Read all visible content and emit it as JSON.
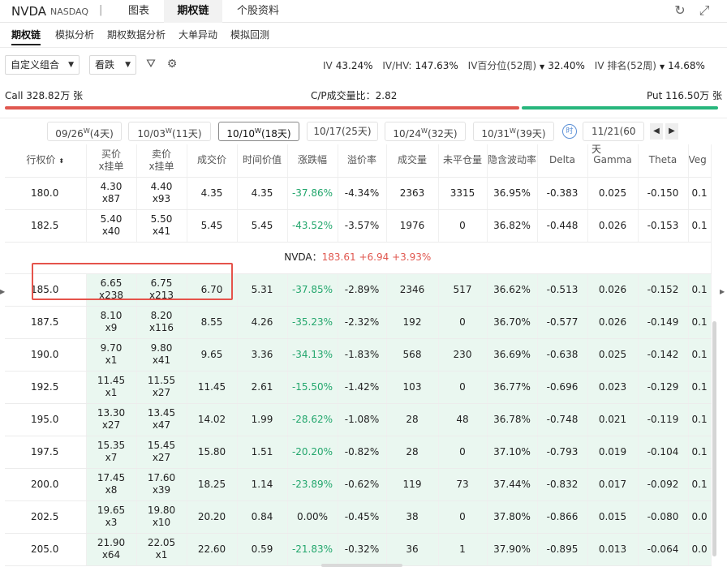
{
  "header": {
    "symbol": "NVDA",
    "exchange": "NASDAQ",
    "separator": "|",
    "tabs": [
      {
        "label": "图表",
        "active": false
      },
      {
        "label": "期权链",
        "active": true
      },
      {
        "label": "个股资料",
        "active": false
      }
    ]
  },
  "subtabs": [
    "期权链",
    "模拟分析",
    "期权数据分析",
    "大单异动",
    "模拟回测"
  ],
  "controls": {
    "strategy": "自定义组合",
    "direction": "看跌"
  },
  "iv_stats": [
    {
      "label": "IV",
      "value": "43.24%"
    },
    {
      "label": "IV/HV:",
      "value": "147.63%"
    },
    {
      "label": "IV百分位(52周)",
      "value": "32.40%"
    },
    {
      "label": "IV 排名(52周)",
      "value": "14.68%"
    }
  ],
  "volume": {
    "call": "Call 328.82万 张",
    "ratio": "C/P成交量比：2.82",
    "put": "Put 116.50万 张"
  },
  "expirations": [
    {
      "date": "09/26",
      "mark": "W",
      "days": "(4天)"
    },
    {
      "date": "10/03",
      "mark": "W",
      "days": "(11天)"
    },
    {
      "date": "10/10",
      "mark": "W",
      "days": "(18天)"
    },
    {
      "date": "10/17",
      "mark": "",
      "days": "(25天)"
    },
    {
      "date": "10/24",
      "mark": "W",
      "days": "(32天)"
    },
    {
      "date": "10/31",
      "mark": "W",
      "days": "(39天)"
    },
    {
      "date": "11/21",
      "mark": "",
      "days": "(60天"
    }
  ],
  "calendar_icon_label": "时",
  "columns": [
    "行权价",
    "买价\nx挂单",
    "卖价\nx挂单",
    "成交价",
    "时间价值",
    "涨跌幅",
    "溢价率",
    "成交量",
    "未平仓量",
    "隐含波动率",
    "Delta",
    "Gamma",
    "Theta",
    "Veg"
  ],
  "stock_line": {
    "label": "NVDA：",
    "price": "183.61",
    "change": "+6.94",
    "pct": "+3.93%"
  },
  "rows_otm": [
    {
      "strike": "180.0",
      "bid": "4.30",
      "bid_size": "x87",
      "ask": "4.40",
      "ask_size": "x93",
      "last": "4.35",
      "time_value": "4.35",
      "chg": "-37.86%",
      "premium": "-4.34%",
      "volume": "2363",
      "oi": "3315",
      "iv": "36.95%",
      "delta": "-0.383",
      "gamma": "0.025",
      "theta": "-0.150",
      "vega": "0.1"
    },
    {
      "strike": "182.5",
      "bid": "5.40",
      "bid_size": "x40",
      "ask": "5.50",
      "ask_size": "x41",
      "last": "5.45",
      "time_value": "5.45",
      "chg": "-43.52%",
      "premium": "-3.57%",
      "volume": "1976",
      "oi": "0",
      "iv": "36.82%",
      "delta": "-0.448",
      "gamma": "0.026",
      "theta": "-0.153",
      "vega": "0.1"
    }
  ],
  "rows_itm": [
    {
      "strike": "185.0",
      "bid": "6.65",
      "bid_size": "x238",
      "ask": "6.75",
      "ask_size": "x213",
      "last": "6.70",
      "time_value": "5.31",
      "chg": "-37.85%",
      "premium": "-2.89%",
      "volume": "2346",
      "oi": "517",
      "iv": "36.62%",
      "delta": "-0.513",
      "gamma": "0.026",
      "theta": "-0.152",
      "vega": "0.1"
    },
    {
      "strike": "187.5",
      "bid": "8.10",
      "bid_size": "x9",
      "ask": "8.20",
      "ask_size": "x116",
      "last": "8.55",
      "time_value": "4.26",
      "chg": "-35.23%",
      "premium": "-2.32%",
      "volume": "192",
      "oi": "0",
      "iv": "36.70%",
      "delta": "-0.577",
      "gamma": "0.026",
      "theta": "-0.149",
      "vega": "0.1"
    },
    {
      "strike": "190.0",
      "bid": "9.70",
      "bid_size": "x1",
      "ask": "9.80",
      "ask_size": "x41",
      "last": "9.65",
      "time_value": "3.36",
      "chg": "-34.13%",
      "premium": "-1.83%",
      "volume": "568",
      "oi": "230",
      "iv": "36.69%",
      "delta": "-0.638",
      "gamma": "0.025",
      "theta": "-0.142",
      "vega": "0.1"
    },
    {
      "strike": "192.5",
      "bid": "11.45",
      "bid_size": "x1",
      "ask": "11.55",
      "ask_size": "x27",
      "last": "11.45",
      "time_value": "2.61",
      "chg": "-15.50%",
      "premium": "-1.42%",
      "volume": "103",
      "oi": "0",
      "iv": "36.77%",
      "delta": "-0.696",
      "gamma": "0.023",
      "theta": "-0.129",
      "vega": "0.1"
    },
    {
      "strike": "195.0",
      "bid": "13.30",
      "bid_size": "x27",
      "ask": "13.45",
      "ask_size": "x47",
      "last": "14.02",
      "time_value": "1.99",
      "chg": "-28.62%",
      "premium": "-1.08%",
      "volume": "28",
      "oi": "48",
      "iv": "36.78%",
      "delta": "-0.748",
      "gamma": "0.021",
      "theta": "-0.119",
      "vega": "0.1"
    },
    {
      "strike": "197.5",
      "bid": "15.35",
      "bid_size": "x7",
      "ask": "15.45",
      "ask_size": "x27",
      "last": "15.80",
      "time_value": "1.51",
      "chg": "-20.20%",
      "premium": "-0.82%",
      "volume": "28",
      "oi": "0",
      "iv": "37.10%",
      "delta": "-0.793",
      "gamma": "0.019",
      "theta": "-0.104",
      "vega": "0.1"
    },
    {
      "strike": "200.0",
      "bid": "17.45",
      "bid_size": "x8",
      "ask": "17.60",
      "ask_size": "x39",
      "last": "18.25",
      "time_value": "1.14",
      "chg": "-23.89%",
      "premium": "-0.62%",
      "volume": "119",
      "oi": "73",
      "iv": "37.44%",
      "delta": "-0.832",
      "gamma": "0.017",
      "theta": "-0.092",
      "vega": "0.1"
    },
    {
      "strike": "202.5",
      "bid": "19.65",
      "bid_size": "x3",
      "ask": "19.80",
      "ask_size": "x10",
      "last": "20.20",
      "time_value": "0.84",
      "chg": "0.00%",
      "premium": "-0.45%",
      "volume": "38",
      "oi": "0",
      "iv": "37.80%",
      "delta": "-0.866",
      "gamma": "0.015",
      "theta": "-0.080",
      "vega": "0.0"
    },
    {
      "strike": "205.0",
      "bid": "21.90",
      "bid_size": "x64",
      "ask": "22.05",
      "ask_size": "x1",
      "last": "22.60",
      "time_value": "0.59",
      "chg": "-21.83%",
      "premium": "-0.32%",
      "volume": "36",
      "oi": "1",
      "iv": "37.90%",
      "delta": "-0.895",
      "gamma": "0.013",
      "theta": "-0.064",
      "vega": "0.0"
    }
  ],
  "colors": {
    "up": "#e0574f",
    "down": "#22a66c",
    "itm_bg": "#eaf7f0",
    "highlight_box": "#e5534b"
  },
  "icons": {
    "refresh": "refresh-icon",
    "expand": "expand-icon",
    "filter": "filter-icon",
    "settings": "gear-icon"
  }
}
